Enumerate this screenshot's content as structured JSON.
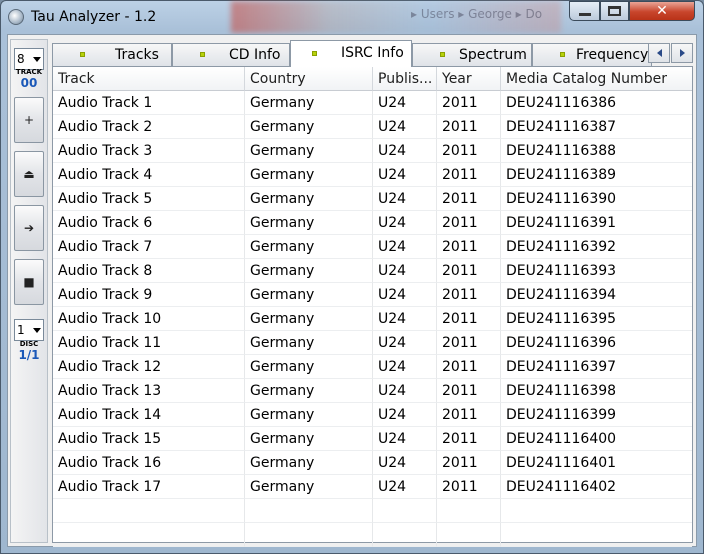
{
  "window": {
    "title": "Tau Analyzer - 1.2",
    "background_text": "▸ Users ▸ George ▸ Do"
  },
  "toolbar": {
    "track_select": "8",
    "track_caption": "TRACK",
    "track_value": "00",
    "buttons": [
      {
        "icon": "plus-icon",
        "glyph": "+"
      },
      {
        "icon": "eject-icon",
        "glyph": "⏏"
      },
      {
        "icon": "play-icon",
        "glyph": "➔"
      },
      {
        "icon": "stop-icon",
        "glyph": "■"
      }
    ],
    "disc_select": "1",
    "disc_caption": "DISC",
    "disc_value": "1/1"
  },
  "tabs": [
    "Tracks",
    "CD Info",
    "ISRC Info",
    "Spectrum",
    "Frequency"
  ],
  "active_tab": "ISRC Info",
  "accent_color": "#b7d20b",
  "table": {
    "columns": [
      "Track",
      "Country",
      "Publis...",
      "Year",
      "Media Catalog Number"
    ],
    "rows": [
      [
        "Audio Track 1",
        "Germany",
        "U24",
        "2011",
        "DEU241116386"
      ],
      [
        "Audio Track 2",
        "Germany",
        "U24",
        "2011",
        "DEU241116387"
      ],
      [
        "Audio Track 3",
        "Germany",
        "U24",
        "2011",
        "DEU241116388"
      ],
      [
        "Audio Track 4",
        "Germany",
        "U24",
        "2011",
        "DEU241116389"
      ],
      [
        "Audio Track 5",
        "Germany",
        "U24",
        "2011",
        "DEU241116390"
      ],
      [
        "Audio Track 6",
        "Germany",
        "U24",
        "2011",
        "DEU241116391"
      ],
      [
        "Audio Track 7",
        "Germany",
        "U24",
        "2011",
        "DEU241116392"
      ],
      [
        "Audio Track 8",
        "Germany",
        "U24",
        "2011",
        "DEU241116393"
      ],
      [
        "Audio Track 9",
        "Germany",
        "U24",
        "2011",
        "DEU241116394"
      ],
      [
        "Audio Track 10",
        "Germany",
        "U24",
        "2011",
        "DEU241116395"
      ],
      [
        "Audio Track 11",
        "Germany",
        "U24",
        "2011",
        "DEU241116396"
      ],
      [
        "Audio Track 12",
        "Germany",
        "U24",
        "2011",
        "DEU241116397"
      ],
      [
        "Audio Track 13",
        "Germany",
        "U24",
        "2011",
        "DEU241116398"
      ],
      [
        "Audio Track 14",
        "Germany",
        "U24",
        "2011",
        "DEU241116399"
      ],
      [
        "Audio Track 15",
        "Germany",
        "U24",
        "2011",
        "DEU241116400"
      ],
      [
        "Audio Track 16",
        "Germany",
        "U24",
        "2011",
        "DEU241116401"
      ],
      [
        "Audio Track 17",
        "Germany",
        "U24",
        "2011",
        "DEU241116402"
      ]
    ]
  }
}
